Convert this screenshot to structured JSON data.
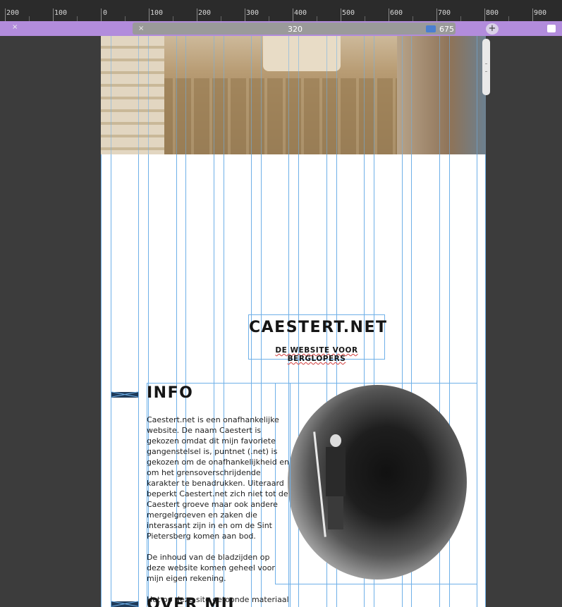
{
  "ruler": {
    "labels": [
      "200",
      "100",
      "0",
      "100",
      "200",
      "300",
      "400",
      "500",
      "600",
      "700",
      "800",
      "900"
    ]
  },
  "media_query_bar": {
    "left_close": "×",
    "inner_close": "×",
    "min_width": "320",
    "max_width": "675",
    "add_icon": "plus-circle-icon"
  },
  "page": {
    "site_title": "CAESTERT.NET",
    "site_subtitle": "DE WEBSITE VOOR BERGLOPERS",
    "info_title": "INFO",
    "info_paragraph_1": "Caestert.net is een onafhankelijke website. De naam Caestert is gekozen omdat dit mijn favoriete gangenstelsel is, puntnet (.net) is gekozen om de onafhankelijkheid en om het grensoverschrijdende karakter te benadrukken. Uiteraard beperkt Caestert.net zich niet tot de Caestert groeve maar ook andere mergelgroeven en zaken die interassant zijn in en om de Sint Pietersberg komen aan bod.",
    "info_paragraph_2": "De inhoud van de bladzijden op deze website komen geheel voor mijn eigen rekening.",
    "info_paragraph_3": "Het op deze site getoonde materiaal",
    "over_title": "OVER MIJ"
  },
  "colors": {
    "guide": "#6fb0e8",
    "mq_bar": "#b28cdc",
    "heading": "#151515"
  }
}
